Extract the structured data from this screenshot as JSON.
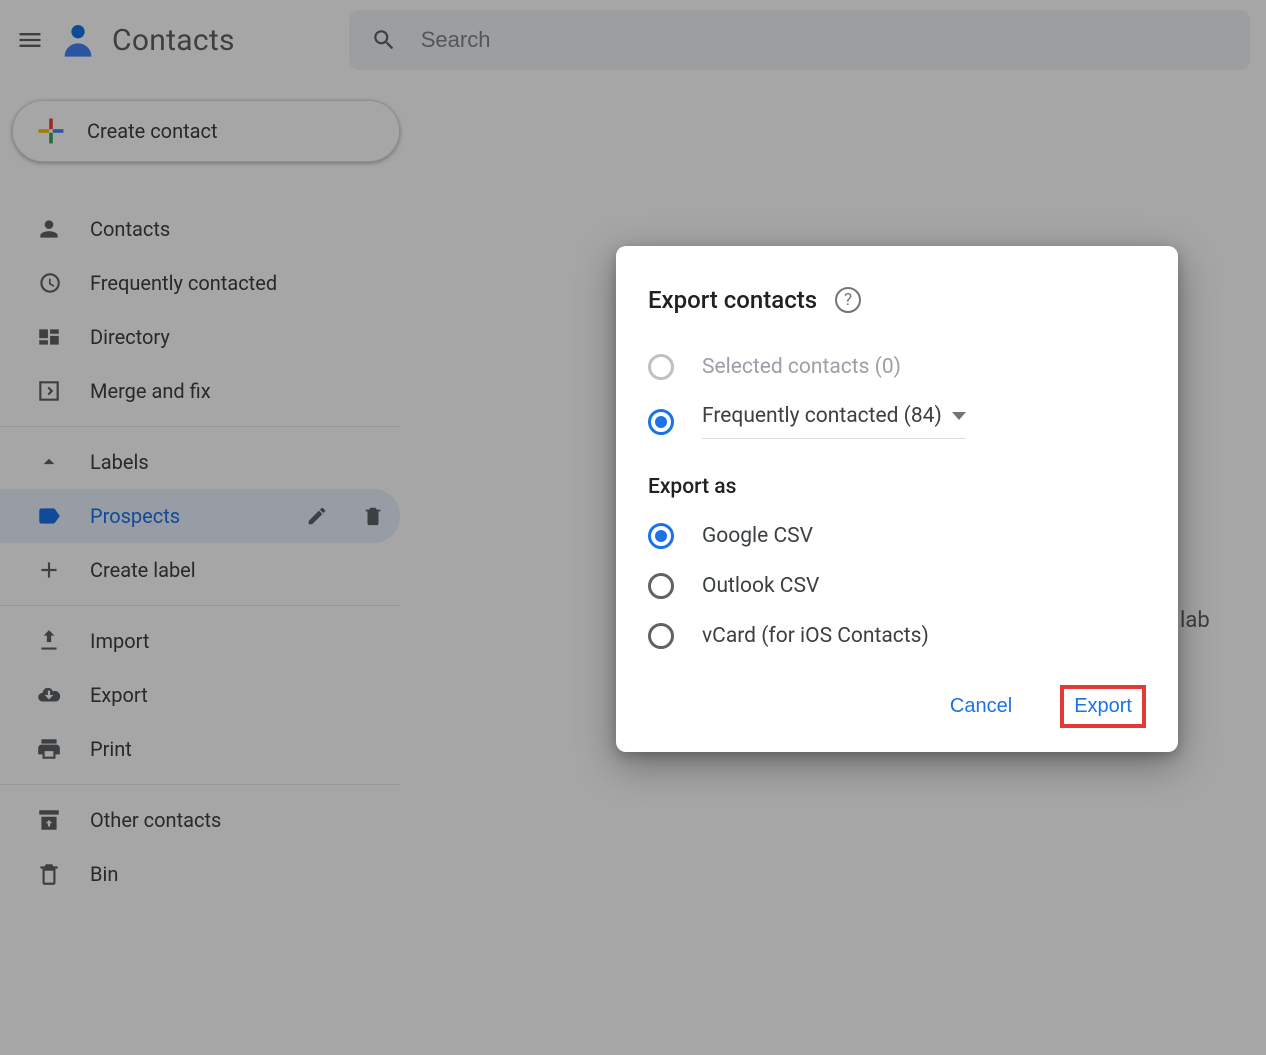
{
  "header": {
    "app_title": "Contacts",
    "search_placeholder": "Search"
  },
  "sidebar": {
    "create_label": "Create contact",
    "nav": {
      "contacts": "Contacts",
      "frequent": "Frequently contacted",
      "directory": "Directory",
      "merge": "Merge and fix",
      "labels_header": "Labels",
      "label_prospects": "Prospects",
      "create_label": "Create label",
      "import": "Import",
      "export": "Export",
      "print": "Print",
      "other": "Other contacts",
      "bin": "Bin"
    }
  },
  "dialog": {
    "title": "Export contacts",
    "option_selected": "Selected contacts (0)",
    "option_source": "Frequently contacted (84)",
    "export_as_heading": "Export as",
    "fmt_google": "Google CSV",
    "fmt_outlook": "Outlook CSV",
    "fmt_vcard": "vCard (for iOS Contacts)",
    "cancel": "Cancel",
    "export": "Export"
  },
  "background": {
    "partial": "lab"
  }
}
